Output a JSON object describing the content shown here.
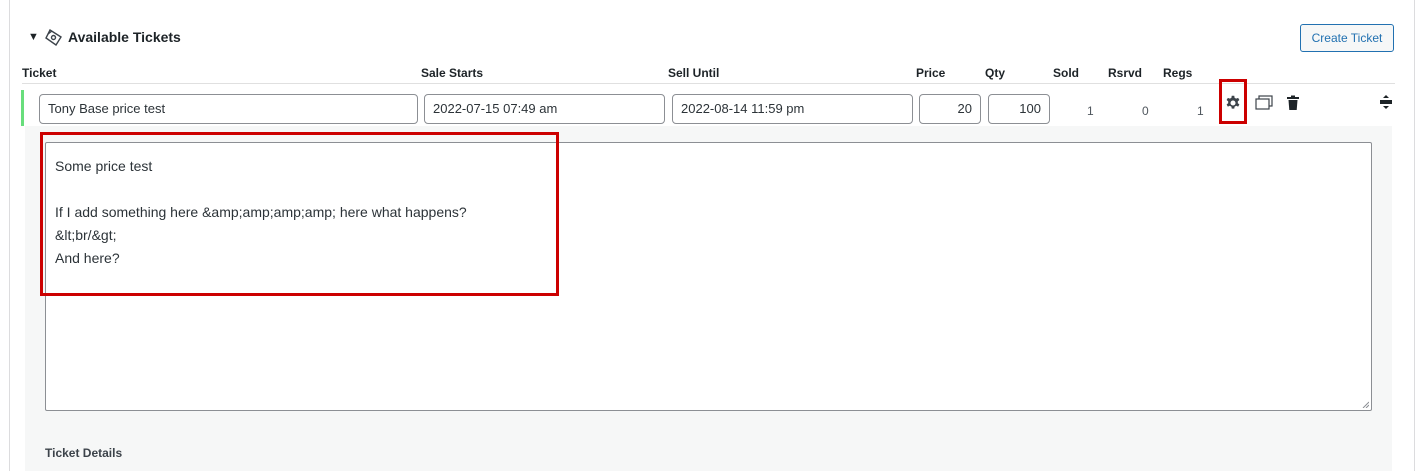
{
  "section": {
    "title": "Available Tickets",
    "create_button": "Create Ticket"
  },
  "columns": {
    "ticket": "Ticket",
    "sale_starts": "Sale Starts",
    "sell_until": "Sell Until",
    "price": "Price",
    "qty": "Qty",
    "sold": "Sold",
    "rsrvd": "Rsrvd",
    "regs": "Regs"
  },
  "ticket_row": {
    "name": "Tony Base price test",
    "sale_starts": "2022-07-15 07:49 am",
    "sell_until": "2022-08-14 11:59 pm",
    "price": "20",
    "qty": "100",
    "sold": "1",
    "rsrvd": "0",
    "regs": "1",
    "status_color": "#68de7c"
  },
  "description": {
    "lines": [
      "Some price test",
      "",
      "If I add something here &amp;amp;amp;amp; here what happens?",
      "&lt;br/&gt;",
      "And here?"
    ]
  },
  "details": {
    "label": "Ticket Details"
  },
  "icons": {
    "settings": "gear-icon",
    "clone": "copy-icon",
    "trash": "trash-icon",
    "drag": "drag-handle-icon",
    "section": "tickets-icon"
  },
  "colors": {
    "accent": "#2271b1",
    "highlight": "#cc0000"
  }
}
